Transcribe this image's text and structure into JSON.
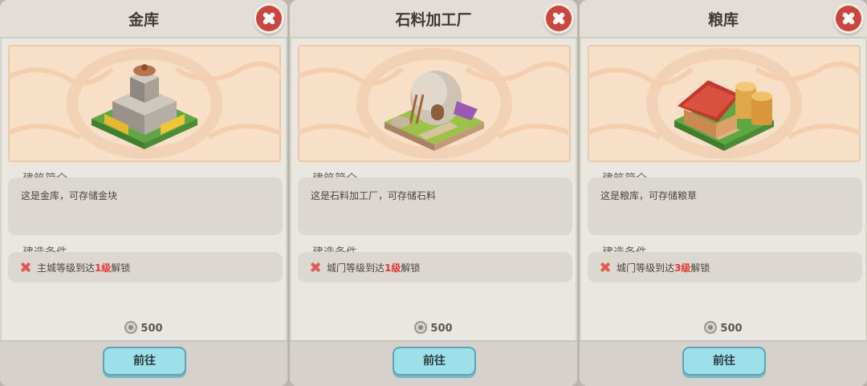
{
  "panels": [
    {
      "title": "金库",
      "intro_label": "建筑简介",
      "description": "这是金库，可存储金块",
      "condition_label": "建造条件",
      "condition_prefix": "主城等级到达",
      "condition_level": "1级",
      "condition_suffix": "解锁",
      "cost": "500",
      "go_label": "前往",
      "building_icon": "gold-vault-building-icon"
    },
    {
      "title": "石料加工厂",
      "intro_label": "建筑简介",
      "description": "这是石料加工厂，可存储石料",
      "condition_label": "建造条件",
      "condition_prefix": "城门等级到达",
      "condition_level": "1级",
      "condition_suffix": "解锁",
      "cost": "500",
      "go_label": "前往",
      "building_icon": "stone-workshop-building-icon"
    },
    {
      "title": "粮库",
      "intro_label": "建筑简介",
      "description": "这是粮库，可存储粮草",
      "condition_label": "建造条件",
      "condition_prefix": "城门等级到达",
      "condition_level": "3级",
      "condition_suffix": "解锁",
      "cost": "500",
      "go_label": "前往",
      "building_icon": "granary-building-icon"
    }
  ],
  "colors": {
    "close_button": "#c9473f",
    "go_button": "#9ee0ea",
    "level_highlight": "#e23a30",
    "illustration_bg": "#f8dfc7"
  }
}
